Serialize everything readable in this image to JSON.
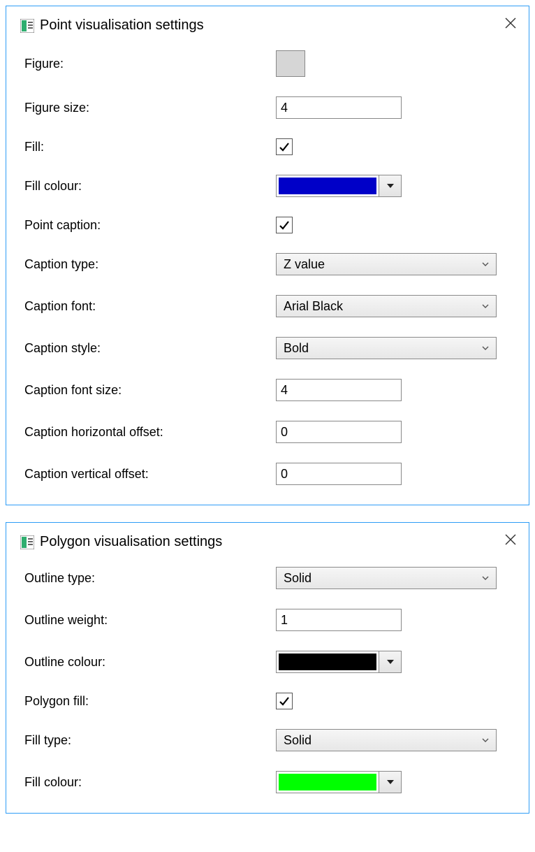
{
  "point": {
    "title": "Point visualisation settings",
    "labels": {
      "figure": "Figure:",
      "figure_size": "Figure size:",
      "fill": "Fill:",
      "fill_colour": "Fill colour:",
      "point_caption": "Point caption:",
      "caption_type": "Caption type:",
      "caption_font": "Caption font:",
      "caption_style": "Caption style:",
      "caption_font_size": "Caption font size:",
      "caption_h_offset": "Caption horizontal offset:",
      "caption_v_offset": "Caption vertical offset:"
    },
    "values": {
      "figure_size": "4",
      "fill_checked": true,
      "fill_colour": "#0000c8",
      "point_caption_checked": true,
      "caption_type": "Z value",
      "caption_font": "Arial Black",
      "caption_style": "Bold",
      "caption_font_size": "4",
      "caption_h_offset": "0",
      "caption_v_offset": "0"
    }
  },
  "polygon": {
    "title": "Polygon visualisation settings",
    "labels": {
      "outline_type": "Outline type:",
      "outline_weight": "Outline weight:",
      "outline_colour": "Outline colour:",
      "polygon_fill": "Polygon fill:",
      "fill_type": "Fill type:",
      "fill_colour": "Fill colour:"
    },
    "values": {
      "outline_type": "Solid",
      "outline_weight": "1",
      "outline_colour": "#000000",
      "polygon_fill_checked": true,
      "fill_type": "Solid",
      "fill_colour": "#00ff00"
    }
  }
}
